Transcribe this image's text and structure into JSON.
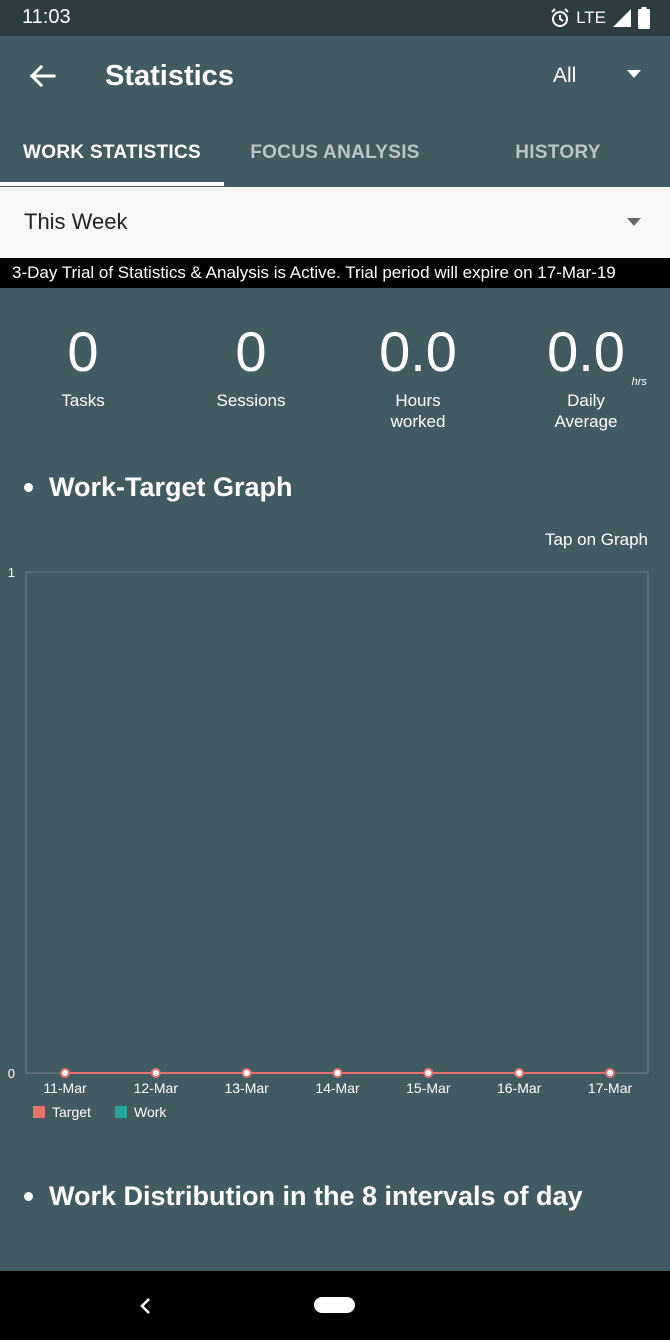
{
  "status_bar": {
    "time": "11:03",
    "network": "LTE",
    "icons": [
      "alarm-icon",
      "signal-icon",
      "battery-icon"
    ]
  },
  "app_bar": {
    "title": "Statistics",
    "filter_value": "All",
    "back_icon": "arrow-left-icon"
  },
  "tabs": [
    {
      "label": "WORK STATISTICS",
      "active": true
    },
    {
      "label": "FOCUS ANALYSIS",
      "active": false
    },
    {
      "label": "HISTORY",
      "active": false
    }
  ],
  "range_selector": {
    "value": "This Week"
  },
  "trial_banner": {
    "text": "3-Day Trial of Statistics & Analysis is Active. Trial period will expire on 17-Mar-19"
  },
  "stats": [
    {
      "value": "0",
      "label": "Tasks",
      "unit": ""
    },
    {
      "value": "0",
      "label": "Sessions",
      "unit": ""
    },
    {
      "value": "0.0",
      "label": "Hours worked",
      "unit": ""
    },
    {
      "value": "0.0",
      "label": "Daily Average",
      "unit": "hrs"
    }
  ],
  "sections": {
    "work_target_title": "Work-Target Graph",
    "tap_hint": "Tap on Graph",
    "distribution_title": "Work Distribution in the 8 intervals of day"
  },
  "colors": {
    "background": "#425a61",
    "target": "#e57373",
    "work": "#26a69a"
  },
  "chart_data": {
    "type": "line",
    "categories": [
      "11-Mar",
      "12-Mar",
      "13-Mar",
      "14-Mar",
      "15-Mar",
      "16-Mar",
      "17-Mar"
    ],
    "series": [
      {
        "name": "Target",
        "values": [
          0,
          0,
          0,
          0,
          0,
          0,
          0
        ],
        "color": "#e57373"
      },
      {
        "name": "Work",
        "values": [],
        "color": "#26a69a"
      }
    ],
    "ylim": [
      0,
      1
    ],
    "yticks": [
      "0",
      "1"
    ],
    "legend": "bottom-left",
    "grid": false
  }
}
